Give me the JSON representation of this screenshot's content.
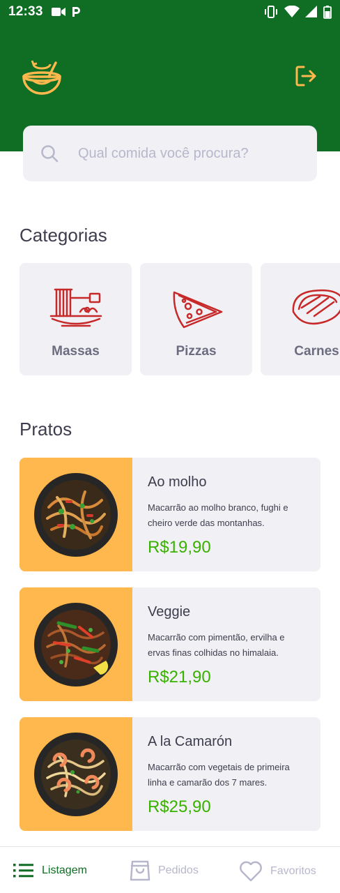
{
  "status_bar": {
    "time": "12:33"
  },
  "search": {
    "placeholder": "Qual comida você procura?"
  },
  "sections": {
    "categories": "Categorias",
    "dishes": "Pratos"
  },
  "categories": [
    {
      "label": "Massas",
      "icon": "pasta-icon"
    },
    {
      "label": "Pizzas",
      "icon": "pizza-icon"
    },
    {
      "label": "Carnes",
      "icon": "meat-icon"
    }
  ],
  "dishes": [
    {
      "name": "Ao molho",
      "description": "Macarrão ao molho branco, fughi e cheiro verde das montanhas.",
      "price": "R$19,90"
    },
    {
      "name": "Veggie",
      "description": "Macarrão com pimentão, ervilha e ervas finas colhidas no himalaia.",
      "price": "R$21,90"
    },
    {
      "name": "A la Camarón",
      "description": "Macarrão com vegetais de primeira linha e camarão dos 7 mares.",
      "price": "R$25,90"
    }
  ],
  "nav": {
    "listing": "Listagem",
    "orders": "Pedidos",
    "favorites": "Favoritos"
  },
  "colors": {
    "primary": "#0f6d24",
    "accent": "#ffb84d",
    "price": "#39b100",
    "icon_red": "#c72828",
    "card_bg": "#f0f0f5"
  }
}
